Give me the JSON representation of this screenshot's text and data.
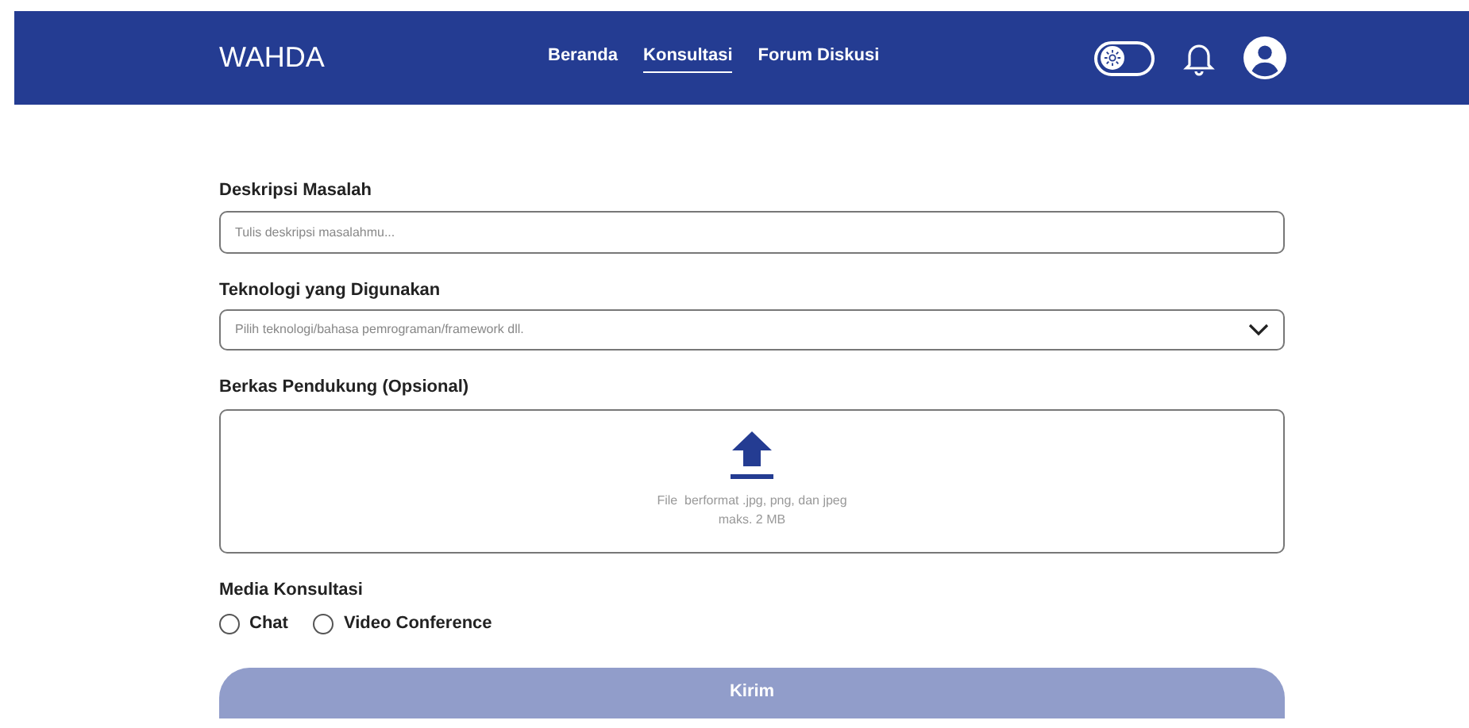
{
  "navbar": {
    "brand": "WAHDA",
    "links": [
      {
        "label": "Beranda",
        "selected": false
      },
      {
        "label": "Konsultasi",
        "selected": true
      },
      {
        "label": "Forum Diskusi",
        "selected": false
      }
    ],
    "theme_toggle": {
      "on": false
    }
  },
  "form": {
    "description": {
      "label": "Deskripsi Masalah",
      "placeholder": "Tulis deskripsi masalahmu..."
    },
    "technology": {
      "label": "Teknologi yang Digunakan",
      "placeholder": "Pilih teknologi/bahasa pemrograman/framework dll."
    },
    "attachment": {
      "label": "Berkas Pendukung (Opsional)",
      "hint_lines": [
        "File  berformat .jpg, png, dan jpeg",
        "maks. 2 MB"
      ]
    },
    "media": {
      "label": "Media Konsultasi",
      "options": [
        {
          "label": "Chat",
          "selected": false
        },
        {
          "label": "Video Conference",
          "selected": false
        }
      ]
    },
    "submit": {
      "label": "Kirim",
      "disabled": true
    }
  }
}
